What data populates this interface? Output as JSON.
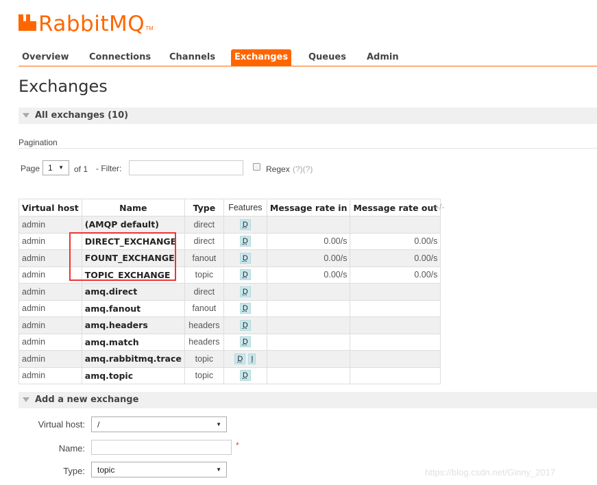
{
  "brand": {
    "name": "RabbitMQ",
    "tm": "TM"
  },
  "nav": {
    "tabs": [
      {
        "label": "Overview"
      },
      {
        "label": "Connections"
      },
      {
        "label": "Channels"
      },
      {
        "label": "Exchanges"
      },
      {
        "label": "Queues"
      },
      {
        "label": "Admin"
      }
    ],
    "active": "Exchanges"
  },
  "page_title": "Exchanges",
  "all_exchanges": {
    "header": "All exchanges (10)",
    "pagination_label": "Pagination",
    "page_label": "Page",
    "page_value": "1",
    "of_label": "of 1",
    "filter_label": "- Filter:",
    "filter_value": "",
    "regex_label": "Regex",
    "regex_help": "(?)(?)",
    "plus_minus": "+/-",
    "columns": [
      "Virtual host",
      "Name",
      "Type",
      "Features",
      "Message rate in",
      "Message rate out"
    ],
    "rows": [
      {
        "vhost": "admin",
        "name": "(AMQP default)",
        "type": "direct",
        "features": [
          "D"
        ],
        "rate_in": "",
        "rate_out": ""
      },
      {
        "vhost": "admin",
        "name": "DIRECT_EXCHANGE",
        "type": "direct",
        "features": [
          "D"
        ],
        "rate_in": "0.00/s",
        "rate_out": "0.00/s"
      },
      {
        "vhost": "admin",
        "name": "FOUNT_EXCHANGE",
        "type": "fanout",
        "features": [
          "D"
        ],
        "rate_in": "0.00/s",
        "rate_out": "0.00/s"
      },
      {
        "vhost": "admin",
        "name": "TOPIC_EXCHANGE",
        "type": "topic",
        "features": [
          "D"
        ],
        "rate_in": "0.00/s",
        "rate_out": "0.00/s"
      },
      {
        "vhost": "admin",
        "name": "amq.direct",
        "type": "direct",
        "features": [
          "D"
        ],
        "rate_in": "",
        "rate_out": ""
      },
      {
        "vhost": "admin",
        "name": "amq.fanout",
        "type": "fanout",
        "features": [
          "D"
        ],
        "rate_in": "",
        "rate_out": ""
      },
      {
        "vhost": "admin",
        "name": "amq.headers",
        "type": "headers",
        "features": [
          "D"
        ],
        "rate_in": "",
        "rate_out": ""
      },
      {
        "vhost": "admin",
        "name": "amq.match",
        "type": "headers",
        "features": [
          "D"
        ],
        "rate_in": "",
        "rate_out": ""
      },
      {
        "vhost": "admin",
        "name": "amq.rabbitmq.trace",
        "type": "topic",
        "features": [
          "D",
          "I"
        ],
        "rate_in": "",
        "rate_out": ""
      },
      {
        "vhost": "admin",
        "name": "amq.topic",
        "type": "topic",
        "features": [
          "D"
        ],
        "rate_in": "",
        "rate_out": ""
      }
    ]
  },
  "add_exchange": {
    "header": "Add a new exchange",
    "vhost_label": "Virtual host:",
    "vhost_value": "/",
    "name_label": "Name:",
    "name_value": "",
    "required_mark": "*",
    "type_label": "Type:",
    "type_value": "topic"
  },
  "watermark": "https://blog.csdn.net/Ginny_2017",
  "colors": {
    "brand": "#ff6600",
    "highlight": "#e33333",
    "badge": "#c9e8ec"
  }
}
